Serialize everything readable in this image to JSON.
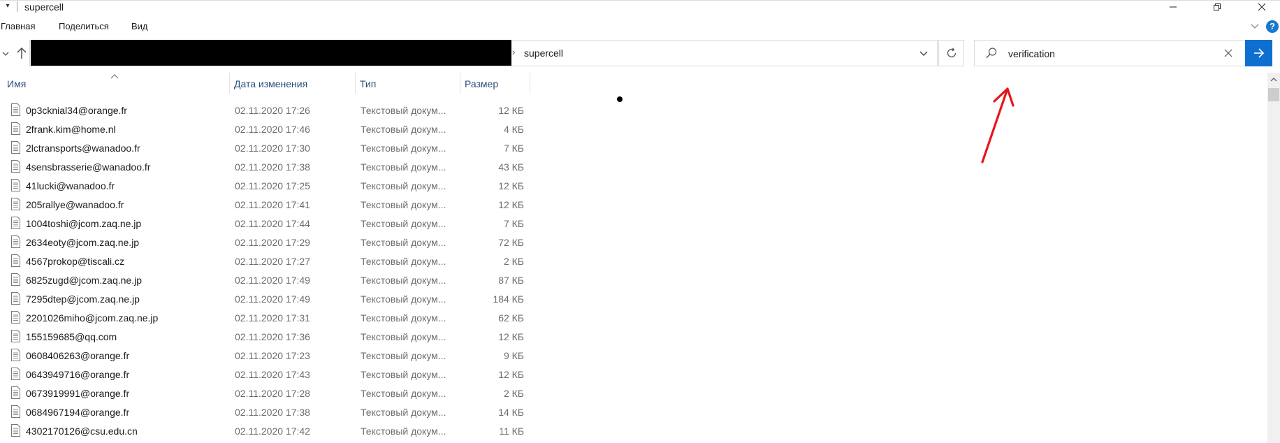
{
  "window": {
    "title": "supercell"
  },
  "ribbon": {
    "tabs": [
      "Главная",
      "Поделиться",
      "Вид"
    ],
    "help_label": "?"
  },
  "address": {
    "current_folder": "supercell",
    "path_redacted": true
  },
  "search": {
    "value": "verification",
    "accent_color": "#0f6fd1"
  },
  "annotation": {
    "arrow_color": "#e8141c"
  },
  "columns": {
    "name": "Имя",
    "date": "Дата изменения",
    "type": "Тип",
    "size": "Размер"
  },
  "files": [
    {
      "name": "0p3cknial34@orange.fr",
      "date": "02.11.2020 17:26",
      "type": "Текстовый докум...",
      "size": "12 КБ"
    },
    {
      "name": "2frank.kim@home.nl",
      "date": "02.11.2020 17:46",
      "type": "Текстовый докум...",
      "size": "4 КБ"
    },
    {
      "name": "2lctransports@wanadoo.fr",
      "date": "02.11.2020 17:30",
      "type": "Текстовый докум...",
      "size": "7 КБ"
    },
    {
      "name": "4sensbrasserie@wanadoo.fr",
      "date": "02.11.2020 17:38",
      "type": "Текстовый докум...",
      "size": "43 КБ"
    },
    {
      "name": "41lucki@wanadoo.fr",
      "date": "02.11.2020 17:25",
      "type": "Текстовый докум...",
      "size": "12 КБ"
    },
    {
      "name": "205rallye@wanadoo.fr",
      "date": "02.11.2020 17:41",
      "type": "Текстовый докум...",
      "size": "12 КБ"
    },
    {
      "name": "1004toshi@jcom.zaq.ne.jp",
      "date": "02.11.2020 17:44",
      "type": "Текстовый докум...",
      "size": "7 КБ"
    },
    {
      "name": "2634eoty@jcom.zaq.ne.jp",
      "date": "02.11.2020 17:29",
      "type": "Текстовый докум...",
      "size": "72 КБ"
    },
    {
      "name": "4567prokop@tiscali.cz",
      "date": "02.11.2020 17:27",
      "type": "Текстовый докум...",
      "size": "2 КБ"
    },
    {
      "name": "6825zugd@jcom.zaq.ne.jp",
      "date": "02.11.2020 17:49",
      "type": "Текстовый докум...",
      "size": "87 КБ"
    },
    {
      "name": "7295dtep@jcom.zaq.ne.jp",
      "date": "02.11.2020 17:49",
      "type": "Текстовый докум...",
      "size": "184 КБ"
    },
    {
      "name": "2201026miho@jcom.zaq.ne.jp",
      "date": "02.11.2020 17:31",
      "type": "Текстовый докум...",
      "size": "62 КБ"
    },
    {
      "name": "155159685@qq.com",
      "date": "02.11.2020 17:36",
      "type": "Текстовый докум...",
      "size": "12 КБ"
    },
    {
      "name": "0608406263@orange.fr",
      "date": "02.11.2020 17:23",
      "type": "Текстовый докум...",
      "size": "9 КБ"
    },
    {
      "name": "0643949716@orange.fr",
      "date": "02.11.2020 17:43",
      "type": "Текстовый докум...",
      "size": "12 КБ"
    },
    {
      "name": "0673919991@orange.fr",
      "date": "02.11.2020 17:28",
      "type": "Текстовый докум...",
      "size": "2 КБ"
    },
    {
      "name": "0684967194@orange.fr",
      "date": "02.11.2020 17:38",
      "type": "Текстовый докум...",
      "size": "14 КБ"
    },
    {
      "name": "4302170126@csu.edu.cn",
      "date": "02.11.2020 17:42",
      "type": "Текстовый докум...",
      "size": "11 КБ"
    }
  ]
}
